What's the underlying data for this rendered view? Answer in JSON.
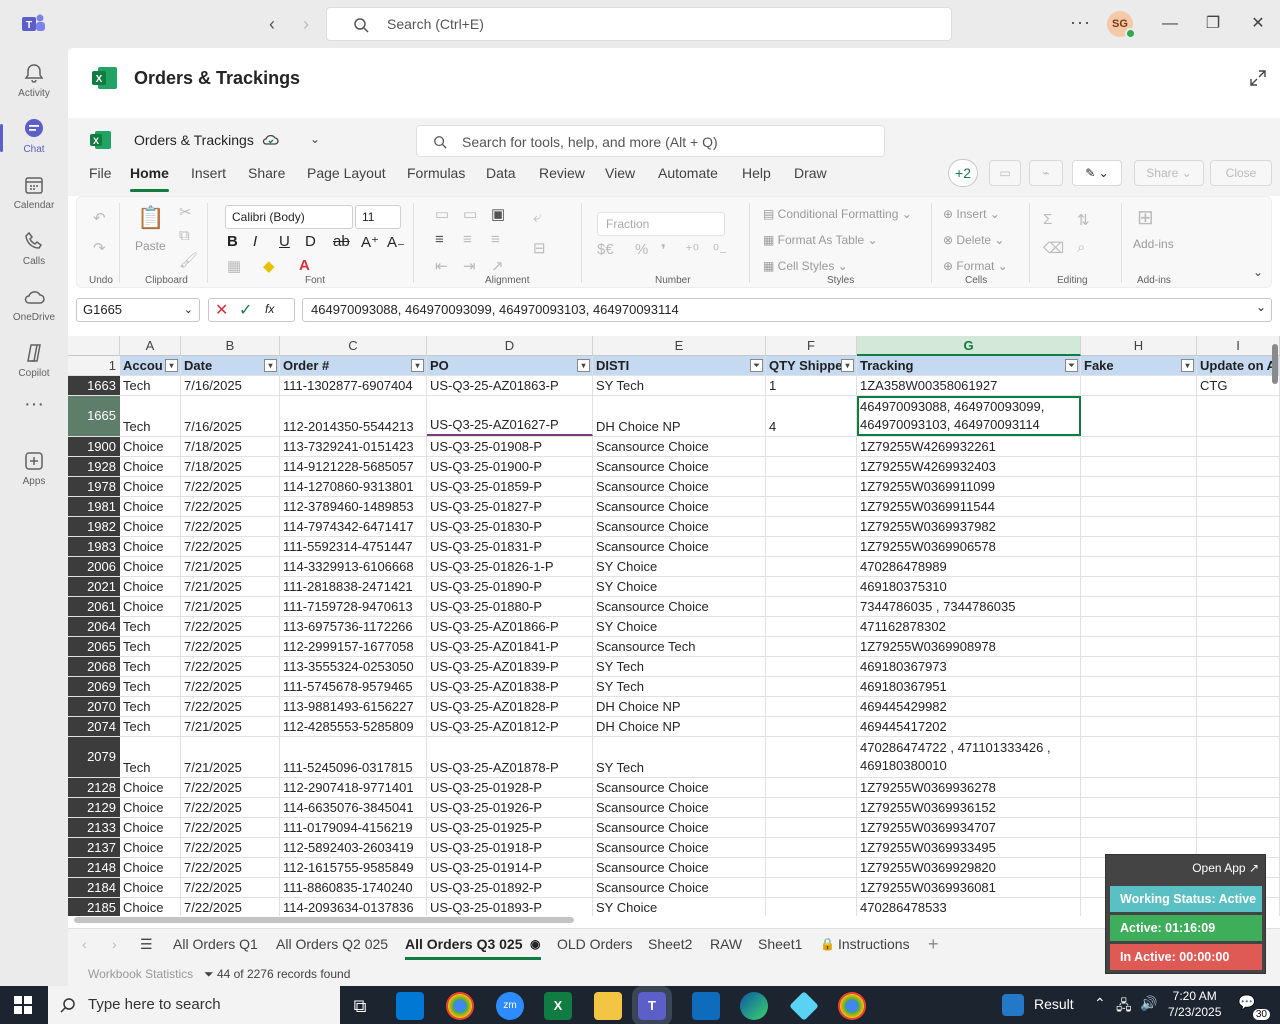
{
  "topbar": {
    "search_placeholder": "Search (Ctrl+E)",
    "avatar_initials": "SG"
  },
  "rail": [
    {
      "label": "Activity",
      "icon": "bell-icon"
    },
    {
      "label": "Chat",
      "icon": "chat-icon"
    },
    {
      "label": "Calendar",
      "icon": "calendar-icon"
    },
    {
      "label": "Calls",
      "icon": "phone-icon"
    },
    {
      "label": "OneDrive",
      "icon": "cloud-icon"
    },
    {
      "label": "Copilot",
      "icon": "copilot-icon"
    },
    {
      "label": "Apps",
      "icon": "apps-icon"
    }
  ],
  "app": {
    "title": "Orders & Trackings",
    "file_name": "Orders & Trackings",
    "tools_search": "Search for tools, help, and more (Alt + Q)"
  },
  "menu": [
    "File",
    "Home",
    "Insert",
    "Share",
    "Page Layout",
    "Formulas",
    "Data",
    "Review",
    "View",
    "Automate",
    "Help",
    "Draw"
  ],
  "menu_extra": {
    "plus": "+2",
    "share": "Share",
    "close": "Close"
  },
  "ribbon": {
    "undo": "Undo",
    "paste": "Paste",
    "clipboard": "Clipboard",
    "font_name": "Calibri (Body)",
    "font_size": "11",
    "font": "Font",
    "alignment": "Alignment",
    "number_format": "Fraction",
    "number": "Number",
    "conditional_formatting": "Conditional Formatting",
    "format_as_table": "Format As Table",
    "cell_styles": "Cell Styles",
    "styles": "Styles",
    "insert": "Insert",
    "delete": "Delete",
    "format": "Format",
    "cells": "Cells",
    "editing": "Editing",
    "addins": "Add-ins",
    "addins_group": "Add-ins"
  },
  "formula": {
    "name_box": "G1665",
    "fx": "fx",
    "content": "464970093088, 464970093099, 464970093103, 464970093114"
  },
  "columns": [
    "A",
    "B",
    "C",
    "D",
    "E",
    "F",
    "G",
    "H",
    "I"
  ],
  "headers": [
    "Accou",
    "Date",
    "Order #",
    "PO",
    "DISTI",
    "QTY Shippe",
    "Tracking",
    "Fake",
    "Update on A"
  ],
  "rows": [
    {
      "n": "1663",
      "a": "Tech",
      "b": "7/16/2025",
      "c": "111-1302877-6907404",
      "d": "US-Q3-25-AZ01863-P",
      "e": "SY Tech",
      "f": "1",
      "g": "1ZA358W00358061927",
      "h": "",
      "i": "CTG"
    },
    {
      "n": "1665",
      "a": "Tech",
      "b": "7/16/2025",
      "c": "112-2014350-5544213",
      "d": "US-Q3-25-AZ01627-P",
      "e": "DH Choice NP",
      "f": "4",
      "g": "464970093088, 464970093099, 464970093103, 464970093114",
      "h": "",
      "i": ""
    },
    {
      "n": "1900",
      "a": "Choice",
      "b": "7/18/2025",
      "c": "113-7329241-0151423",
      "d": "US-Q3-25-01908-P",
      "e": "Scansource Choice",
      "f": "",
      "g": "1Z79255W4269932261",
      "h": "",
      "i": ""
    },
    {
      "n": "1928",
      "a": "Choice",
      "b": "7/18/2025",
      "c": "114-9121228-5685057",
      "d": "US-Q3-25-01900-P",
      "e": "Scansource Choice",
      "f": "",
      "g": "1Z79255W4269932403",
      "h": "",
      "i": ""
    },
    {
      "n": "1978",
      "a": "Choice",
      "b": "7/22/2025",
      "c": "114-1270860-9313801",
      "d": "US-Q3-25-01859-P",
      "e": "Scansource Choice",
      "f": "",
      "g": "1Z79255W0369911099",
      "h": "",
      "i": ""
    },
    {
      "n": "1981",
      "a": "Choice",
      "b": "7/22/2025",
      "c": "112-3789460-1489853",
      "d": "US-Q3-25-01827-P",
      "e": "Scansource Choice",
      "f": "",
      "g": "1Z79255W0369911544",
      "h": "",
      "i": ""
    },
    {
      "n": "1982",
      "a": "Choice",
      "b": "7/22/2025",
      "c": "114-7974342-6471417",
      "d": "US-Q3-25-01830-P",
      "e": "Scansource Choice",
      "f": "",
      "g": "1Z79255W0369937982",
      "h": "",
      "i": ""
    },
    {
      "n": "1983",
      "a": "Choice",
      "b": "7/22/2025",
      "c": "111-5592314-4751447",
      "d": "US-Q3-25-01831-P",
      "e": "Scansource Choice",
      "f": "",
      "g": "1Z79255W0369906578",
      "h": "",
      "i": ""
    },
    {
      "n": "2006",
      "a": "Choice",
      "b": "7/21/2025",
      "c": "114-3329913-6106668",
      "d": "US-Q3-25-01826-1-P",
      "e": "SY Choice",
      "f": "",
      "g": "470286478989",
      "h": "",
      "i": ""
    },
    {
      "n": "2021",
      "a": "Choice",
      "b": "7/21/2025",
      "c": "111-2818838-2471421",
      "d": "US-Q3-25-01890-P",
      "e": "SY Choice",
      "f": "",
      "g": "469180375310",
      "h": "",
      "i": ""
    },
    {
      "n": "2061",
      "a": "Choice",
      "b": "7/21/2025",
      "c": "111-7159728-9470613",
      "d": "US-Q3-25-01880-P",
      "e": "Scansource Choice",
      "f": "",
      "g": "7344786035 , 7344786035",
      "h": "",
      "i": ""
    },
    {
      "n": "2064",
      "a": "Tech",
      "b": "7/22/2025",
      "c": "113-6975736-1172266",
      "d": "US-Q3-25-AZ01866-P",
      "e": "SY Choice",
      "f": "",
      "g": "471162878302",
      "h": "",
      "i": ""
    },
    {
      "n": "2065",
      "a": "Tech",
      "b": "7/22/2025",
      "c": "112-2999157-1677058",
      "d": "US-Q3-25-AZ01841-P",
      "e": "Scansource Tech",
      "f": "",
      "g": "1Z79255W0369908978",
      "h": "",
      "i": ""
    },
    {
      "n": "2068",
      "a": "Tech",
      "b": "7/22/2025",
      "c": "113-3555324-0253050",
      "d": "US-Q3-25-AZ01839-P",
      "e": "SY Tech",
      "f": "",
      "g": "469180367973",
      "h": "",
      "i": ""
    },
    {
      "n": "2069",
      "a": "Tech",
      "b": "7/22/2025",
      "c": "111-5745678-9579465",
      "d": "US-Q3-25-AZ01838-P",
      "e": "SY Tech",
      "f": "",
      "g": "469180367951",
      "h": "",
      "i": ""
    },
    {
      "n": "2070",
      "a": "Tech",
      "b": "7/22/2025",
      "c": "113-9881493-6156227",
      "d": "US-Q3-25-AZ01828-P",
      "e": "DH Choice NP",
      "f": "",
      "g": "469445429982",
      "h": "",
      "i": ""
    },
    {
      "n": "2074",
      "a": "Tech",
      "b": "7/21/2025",
      "c": "112-4285553-5285809",
      "d": "US-Q3-25-AZ01812-P",
      "e": "DH Choice NP",
      "f": "",
      "g": "469445417202",
      "h": "",
      "i": ""
    },
    {
      "n": "2079",
      "a": "Tech",
      "b": "7/21/2025",
      "c": "111-5245096-0317815",
      "d": "US-Q3-25-AZ01878-P",
      "e": "SY Tech",
      "f": "",
      "g": "470286474722 , 471101333426 , 469180380010",
      "h": "",
      "i": ""
    },
    {
      "n": "2128",
      "a": "Choice",
      "b": "7/22/2025",
      "c": "112-2907418-9771401",
      "d": "US-Q3-25-01928-P",
      "e": "Scansource Choice",
      "f": "",
      "g": "1Z79255W0369936278",
      "h": "",
      "i": ""
    },
    {
      "n": "2129",
      "a": "Choice",
      "b": "7/22/2025",
      "c": "114-6635076-3845041",
      "d": "US-Q3-25-01926-P",
      "e": "Scansource Choice",
      "f": "",
      "g": "1Z79255W0369936152",
      "h": "",
      "i": ""
    },
    {
      "n": "2133",
      "a": "Choice",
      "b": "7/22/2025",
      "c": "111-0179094-4156219",
      "d": "US-Q3-25-01925-P",
      "e": "Scansource Choice",
      "f": "",
      "g": "1Z79255W0369934707",
      "h": "",
      "i": ""
    },
    {
      "n": "2137",
      "a": "Choice",
      "b": "7/22/2025",
      "c": "112-5892403-2603419",
      "d": "US-Q3-25-01918-P",
      "e": "Scansource Choice",
      "f": "",
      "g": "1Z79255W0369933495",
      "h": "",
      "i": ""
    },
    {
      "n": "2148",
      "a": "Choice",
      "b": "7/22/2025",
      "c": "112-1615755-9585849",
      "d": "US-Q3-25-01914-P",
      "e": "Scansource Choice",
      "f": "",
      "g": "1Z79255W0369929820",
      "h": "",
      "i": ""
    },
    {
      "n": "2184",
      "a": "Choice",
      "b": "7/22/2025",
      "c": "111-8860835-1740240",
      "d": "US-Q3-25-01892-P",
      "e": "Scansource Choice",
      "f": "",
      "g": "1Z79255W0369936081",
      "h": "",
      "i": ""
    },
    {
      "n": "2185",
      "a": "Choice",
      "b": "7/22/2025",
      "c": "114-2093634-0137836",
      "d": "US-Q3-25-01893-P",
      "e": "SY Choice",
      "f": "",
      "g": "470286478533",
      "h": "",
      "i": ""
    }
  ],
  "sheets": [
    "All Orders Q1",
    "All Orders Q2 025",
    "All Orders Q3 025",
    "OLD Orders",
    "Sheet2",
    "RAW",
    "Sheet1",
    "Instructions"
  ],
  "status": {
    "workbook_stats": "Workbook Statistics",
    "records": "44 of 2276 records found"
  },
  "widget": {
    "open_app": "Open App",
    "working_status": "Working Status: Active",
    "active": "Active: 01:16:09",
    "inactive": "In Active: 00:00:00"
  },
  "taskbar": {
    "search_placeholder": "Type here to search",
    "result": "Result",
    "time": "7:20 AM",
    "date": "7/23/2025",
    "notifications": "30"
  },
  "colors": {
    "excel_green": "#107c41",
    "teams_purple": "#5b5fc7",
    "table_header": "#c5d9f1",
    "widget_teal": "#5bc0c4",
    "widget_green": "#3fae5a",
    "widget_red": "#e05a55"
  }
}
